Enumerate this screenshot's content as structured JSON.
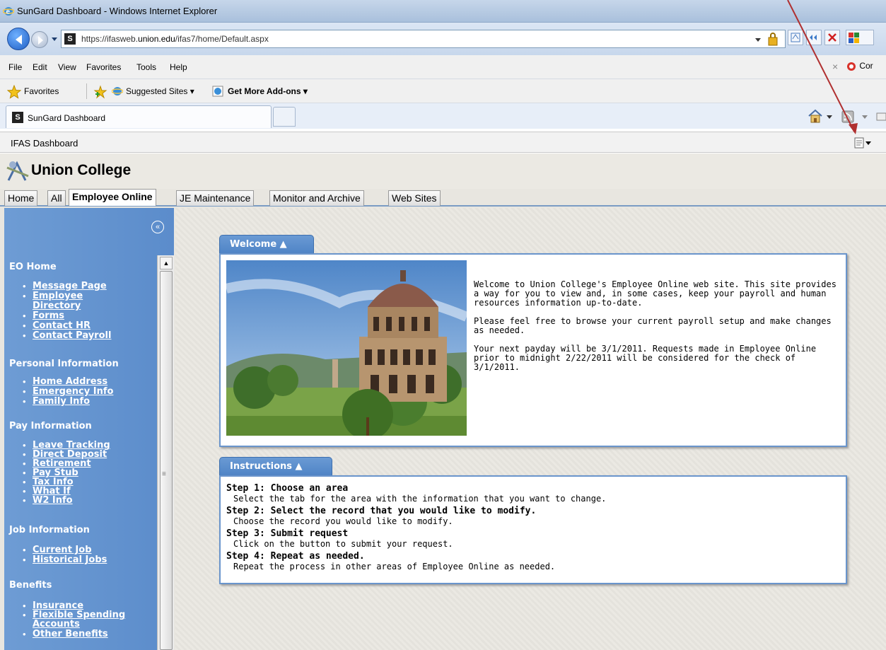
{
  "window": {
    "title": "SunGard Dashboard - Windows Internet Explorer",
    "url_prefix": "https://ifasweb.",
    "url_domain": "union.edu",
    "url_path": "/ifas7/home/Default.aspx"
  },
  "menu": {
    "items": [
      "File",
      "Edit",
      "View",
      "Favorites",
      "Tools",
      "Help"
    ],
    "right_app": "Cor"
  },
  "favorites_bar": {
    "favorites": "Favorites",
    "suggested": "Suggested Sites ▾",
    "addons": "Get More Add-ons ▾"
  },
  "browser_tab": {
    "label": "SunGard Dashboard",
    "favicon": "S"
  },
  "ifas_bar": {
    "label": "IFAS Dashboard"
  },
  "logo": {
    "college": "Union College"
  },
  "app_tabs": [
    {
      "label": "Home"
    },
    {
      "label": "All"
    },
    {
      "label": "Employee Online"
    },
    {
      "label": "JE Maintenance"
    },
    {
      "label": "Monitor and Archive"
    },
    {
      "label": "Web Sites"
    }
  ],
  "sidebar": {
    "collapse": "«",
    "sections": [
      {
        "title": "EO Home",
        "items": [
          "Message Page",
          "Employee",
          "Directory",
          "Forms",
          "Contact HR",
          "Contact Payroll"
        ]
      },
      {
        "title": "Personal Information",
        "items": [
          "Home Address",
          "Emergency Info",
          "Family Info"
        ]
      },
      {
        "title": "Pay Information",
        "items": [
          "Leave Tracking",
          "Direct Deposit",
          "Retirement",
          "Pay Stub",
          "Tax Info",
          "What If",
          "W2 Info"
        ]
      },
      {
        "title": "Job Information",
        "items": [
          "Current Job",
          "Historical Jobs"
        ]
      },
      {
        "title": "Benefits",
        "items": [
          "Insurance",
          "Flexible Spending",
          "Accounts",
          "Other Benefits"
        ]
      }
    ]
  },
  "welcome": {
    "tab_label": "Welcome  ▲",
    "p1": "Welcome to Union College's Employee Online web site. This site provides a way for you to view and, in some cases, keep your payroll and human resources information up-to-date.",
    "p2": "Please feel free to browse your current payroll setup and make changes as needed.",
    "p3": "Your next payday will be 3/1/2011. Requests made in Employee Online prior to midnight 2/22/2011 will be considered for the check of 3/1/2011."
  },
  "instructions": {
    "tab_label": "Instructions  ▲",
    "steps": [
      {
        "title": "Step 1: Choose an area",
        "desc": "Select the tab for the area with the information that you want to change."
      },
      {
        "title": "Step 2: Select the record that you would like to modify.",
        "desc": "Choose the record you would like to modify."
      },
      {
        "title": "Step 3: Submit request",
        "desc": "Click on the button to submit your request."
      },
      {
        "title": "Step 4: Repeat as needed.",
        "desc": "Repeat the process in other areas of Employee Online as needed."
      }
    ]
  },
  "colors": {
    "sidebar": "#5b8ccb",
    "panel_border": "#6a95cc",
    "annotation_arrow": "#b03030"
  }
}
